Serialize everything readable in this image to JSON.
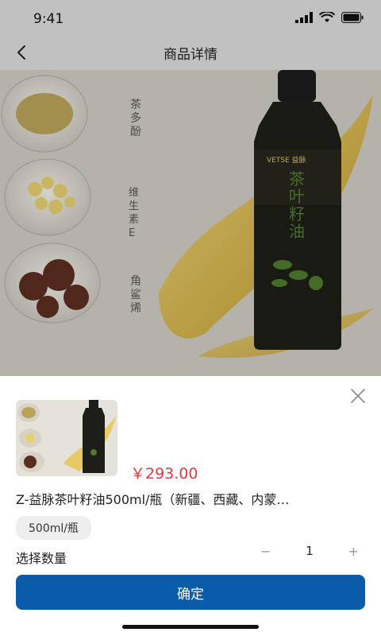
{
  "status_bar": {
    "time": "9:41"
  },
  "nav": {
    "title": "商品详情"
  },
  "hero": {
    "ingredient_1": "茶多酚",
    "ingredient_2": "维生素E",
    "ingredient_3": "角鲨烯",
    "bottle_brand": "VETSE 益脉",
    "bottle_label": "茶叶籽油"
  },
  "sheet": {
    "price": "￥293.00",
    "product_name": "Z-益脉茶叶籽油500ml/瓶（新疆、西藏、内蒙…",
    "spec_option": "500ml/瓶",
    "qty_label": "选择数量",
    "qty_minus": "−",
    "qty_value": "1",
    "qty_plus": "+",
    "confirm_label": "确定"
  },
  "colors": {
    "accent": "#0a5ba8",
    "price": "#e4393c"
  }
}
